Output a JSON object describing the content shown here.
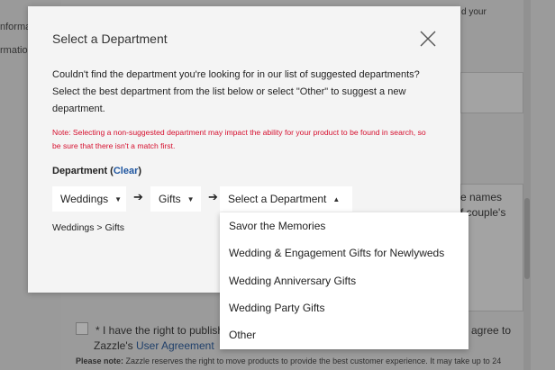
{
  "background": {
    "sidebar_items": [
      "nforma",
      "rmation"
    ],
    "top_right_text": "d your",
    "textarea_snippet_1": "e names",
    "textarea_snippet_2": "f couple's",
    "rights_text": "* I have the right to publish a",
    "agree_text": "agree to",
    "zazzle_text": "Zazzle's",
    "user_agreement_link": "User Agreement",
    "note_label": "Please note:",
    "note_text": "Zazzle reserves the right to move products to provide the best customer experience. It may take up to 24"
  },
  "modal": {
    "title": "Select a Department",
    "intro": "Couldn't find the department you're looking for in our list of suggested departments? Select the best department from the list below or select \"Other\" to suggest a new department.",
    "note": "Note: Selecting a non-suggested department may impact the ability for your product to be found in search, so be sure that there isn't a match first.",
    "department_label": "Department",
    "clear_link": "Clear",
    "dropdowns": {
      "first": "Weddings",
      "second": "Gifts",
      "third": "Select a Department"
    },
    "path": "Weddings > Gifts"
  },
  "menu": {
    "items": [
      "Savor the Memories",
      "Wedding & Engagement Gifts for Newlyweds",
      "Wedding Anniversary Gifts",
      "Wedding Party Gifts",
      "Other"
    ]
  }
}
